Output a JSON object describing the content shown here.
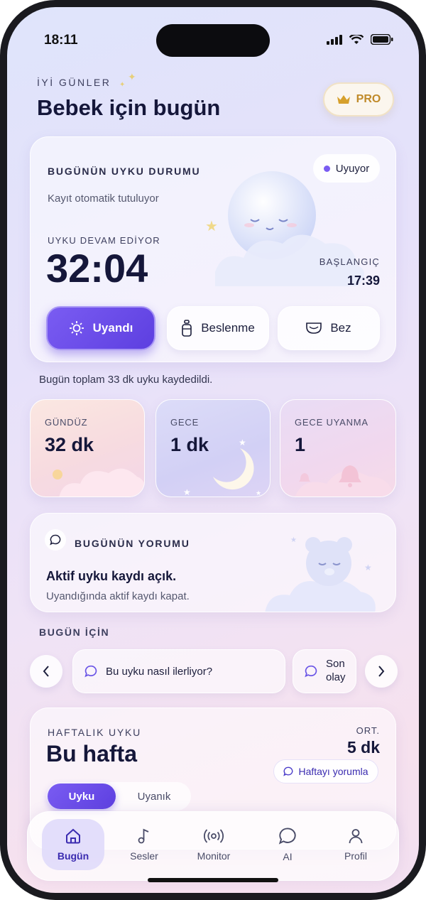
{
  "status": {
    "time": "18:11"
  },
  "header": {
    "greeting": "İYİ GÜNLER",
    "title": "Bebek için bugün",
    "pro_label": "PRO"
  },
  "sleep_card": {
    "heading": "BUGÜNÜN UYKU DURUMU",
    "subtitle": "Kayıt otomatik tutuluyor",
    "status_label": "Uyuyor",
    "elapsed_label": "UYKU DEVAM EDİYOR",
    "elapsed": "32:04",
    "start_label": "BAŞLANGIÇ",
    "start_time": "17:39",
    "buttons": {
      "woke": "Uyandı",
      "feeding": "Beslenme",
      "diaper": "Bez"
    }
  },
  "summary": "Bugün toplam 33 dk uyku kaydedildi.",
  "stats": [
    {
      "label": "GÜNDÜZ",
      "value": "32 dk"
    },
    {
      "label": "GECE",
      "value": "1 dk"
    },
    {
      "label": "GECE UYANMA",
      "value": "1"
    }
  ],
  "comment": {
    "heading": "BUGÜNÜN YORUMU",
    "title": "Aktif uyku kaydı açık.",
    "text": "Uyandığında aktif kaydı kapat."
  },
  "today": {
    "heading": "BUGÜN İÇİN",
    "chips": [
      "Bu uyku nasıl ilerliyor?",
      "Son olay"
    ]
  },
  "weekly": {
    "heading": "HAFTALIK UYKU",
    "title": "Bu hafta",
    "avg_label": "ORT.",
    "avg_value": "5 dk",
    "comment_button": "Haftayı yorumla",
    "toggle": [
      "Uyku",
      "Uyanık"
    ]
  },
  "nav": [
    "Bugün",
    "Sesler",
    "Monitor",
    "AI",
    "Profil"
  ],
  "colors": {
    "accent": "#5d3fe0",
    "gold": "#c08a2a",
    "text": "#15173a"
  }
}
